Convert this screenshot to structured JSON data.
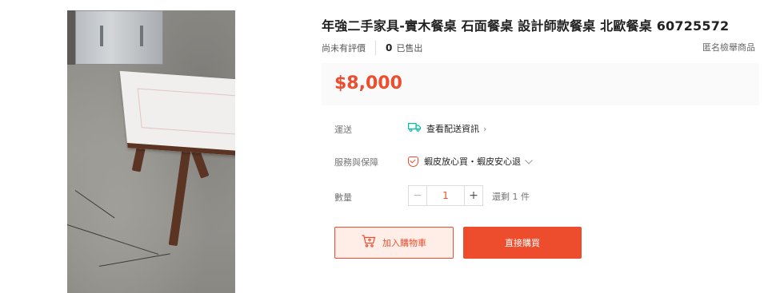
{
  "product": {
    "title": "年強二手家具-實木餐桌 石面餐桌 設計師款餐桌 北歐餐桌 60725572",
    "rating_text": "尚未有評價",
    "sold_count": "0",
    "sold_label": "已售出",
    "report_link": "匿名檢舉商品",
    "price": "$8,000"
  },
  "shipping": {
    "label": "運送",
    "value": "查看配送資訊",
    "icon": "truck-icon"
  },
  "service": {
    "label": "服務與保障",
    "value": "蝦皮放心買・蝦皮安心退",
    "icon": "shield-check-icon"
  },
  "quantity": {
    "label": "數量",
    "value": "1",
    "minus": "−",
    "plus": "+",
    "stock_text": "還剩 1 件"
  },
  "actions": {
    "add_to_cart": "加入購物車",
    "buy_now": "直接購買"
  },
  "colors": {
    "accent": "#ee4d2d",
    "teal": "#00bfa5"
  }
}
